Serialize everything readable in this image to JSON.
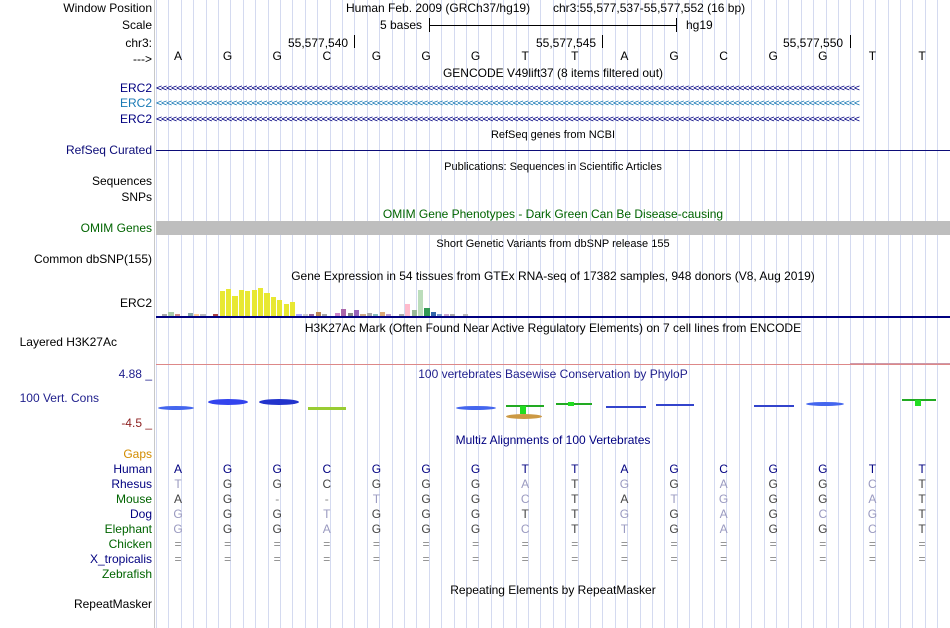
{
  "labels": {
    "window_position": "Window Position",
    "scale": "Scale",
    "chr": "chr3:",
    "arrow": "--->",
    "erc2_a": "ERC2",
    "erc2_b": "ERC2",
    "erc2_c": "ERC2",
    "refseq": "RefSeq Curated",
    "sequences": "Sequences",
    "snps": "SNPs",
    "omim": "OMIM Genes",
    "dbsnp": "Common dbSNP(155)",
    "erc2_gtex": "ERC2",
    "h3k27ac": "Layered H3K27Ac",
    "vert_max": "4.88 _",
    "vert_cons": "100 Vert. Cons",
    "vert_min": "-4.5 _",
    "gaps": "Gaps",
    "repeatmasker": "RepeatMasker"
  },
  "header": {
    "assembly": "Human Feb. 2009 (GRCh37/hg19)",
    "position": "chr3:55,577,537-55,577,552 (16 bp)",
    "scale_text": "5 bases",
    "scale_db": "hg19",
    "coord1": "55,577,540",
    "coord2": "55,577,545",
    "coord3": "55,577,550"
  },
  "bases": [
    "A",
    "G",
    "G",
    "C",
    "G",
    "G",
    "G",
    "T",
    "T",
    "A",
    "G",
    "C",
    "G",
    "G",
    "T",
    "T"
  ],
  "tracks": {
    "gencode": "GENCODE V49lift37 (8 items filtered out)",
    "refseq_title": "RefSeq genes from NCBI",
    "publications": "Publications: Sequences in Scientific Articles",
    "omim_title": "OMIM Gene Phenotypes - Dark Green Can Be Disease-causing",
    "snp_title": "Short Genetic Variants from dbSNP release 155",
    "gtex_title": "Gene Expression in 54 tissues from GTEx RNA-seq of 17382 samples, 948 donors (V8, Aug 2019)",
    "h3k_title": "H3K27Ac Mark (Often Found Near Active Regulatory Elements) on 7 cell lines from ENCODE",
    "phylop_title": "100 vertebrates Basewise Conservation by PhyloP",
    "multiz_title": "Multiz Alignments of 100 Vertebrates",
    "repeat_title": "Repeating Elements by RepeatMasker"
  },
  "gtex_levels": [
    0.03,
    0.12,
    0.02,
    0.0,
    0.1,
    0.02,
    0.04,
    0.0,
    0.02,
    0.78,
    0.85,
    0.62,
    0.82,
    0.78,
    0.8,
    0.88,
    0.72,
    0.58,
    0.5,
    0.38,
    0.44,
    0.05,
    0.02,
    0.04,
    0.12,
    0.06,
    0.0,
    0.1,
    0.22,
    0.08,
    0.18,
    0.04,
    0.08,
    0.02,
    0.14,
    0.06,
    0.0,
    0.04,
    0.38,
    0.2,
    0.82,
    0.24,
    0.12,
    0.04,
    0.06,
    0.02,
    0.0,
    0.03
  ],
  "gtex_colors": [
    "#aaaaaa",
    "#aaccaa",
    "#cc8888",
    "#ffffff",
    "#88aaaa",
    "#ffcc99",
    "#bbbbbb",
    "#ffffff",
    "#aa4444",
    "#e8e832",
    "#e8e832",
    "#e8e832",
    "#e8e832",
    "#e8e832",
    "#e8e832",
    "#e8e832",
    "#e8e832",
    "#e8e832",
    "#e8e832",
    "#e8e832",
    "#e8e832",
    "#aaaaff",
    "#cccccc",
    "#996699",
    "#bb8855",
    "#aaaaaa",
    "#ffffff",
    "#cc88cc",
    "#aa66aa",
    "#888888",
    "#9966bb",
    "#ccaa88",
    "#aaaaaa",
    "#88bbbb",
    "#ddaa77",
    "#bb99cc",
    "#ffffff",
    "#aaaaaa",
    "#ffbbcc",
    "#99bb99",
    "#bbddbb",
    "#339955",
    "#3366aa",
    "#7799cc",
    "#ccaacc",
    "#aaaaaa",
    "#ffffff",
    "#bbbbbb"
  ],
  "alignments": [
    {
      "species": "Human",
      "color": "#000080",
      "seq": [
        "A",
        "G",
        "G",
        "C",
        "G",
        "G",
        "G",
        "T",
        "T",
        "A",
        "G",
        "C",
        "G",
        "G",
        "T",
        "T"
      ]
    },
    {
      "species": "Rhesus",
      "color": "#000080",
      "seq": [
        "T",
        "G",
        "G",
        "C",
        "G",
        "G",
        "G",
        "A",
        "T",
        "G",
        "G",
        "A",
        "G",
        "G",
        "C",
        "T"
      ]
    },
    {
      "species": "Mouse",
      "color": "#006400",
      "seq": [
        "A",
        "G",
        "-",
        "-",
        "T",
        "G",
        "G",
        "C",
        "T",
        "A",
        "T",
        "G",
        "G",
        "G",
        "A",
        "T"
      ]
    },
    {
      "species": "Dog",
      "color": "#000080",
      "seq": [
        "G",
        "G",
        "G",
        "T",
        "G",
        "G",
        "G",
        "T",
        "T",
        "G",
        "G",
        "A",
        "G",
        "C",
        "G",
        "T"
      ]
    },
    {
      "species": "Elephant",
      "color": "#006400",
      "seq": [
        "G",
        "G",
        "G",
        "A",
        "G",
        "G",
        "G",
        "C",
        "T",
        "T",
        "G",
        "A",
        "G",
        "G",
        "C",
        "T"
      ]
    },
    {
      "species": "Chicken",
      "color": "#006400",
      "seq": [
        "=",
        "=",
        "=",
        "=",
        "=",
        "=",
        "=",
        "=",
        "=",
        "=",
        "=",
        "=",
        "=",
        "=",
        "=",
        "="
      ]
    },
    {
      "species": "X_tropicalis",
      "color": "#000080",
      "seq": [
        "=",
        "=",
        "=",
        "=",
        "=",
        "=",
        "=",
        "=",
        "=",
        "=",
        "=",
        "=",
        "=",
        "=",
        "=",
        "="
      ]
    },
    {
      "species": "Zebrafish",
      "color": "#006400",
      "seq": [
        "",
        "",
        "",
        "",
        "",
        "",
        "",
        "",
        "",
        "",
        "",
        "",
        "",
        "",
        "",
        ""
      ]
    }
  ]
}
